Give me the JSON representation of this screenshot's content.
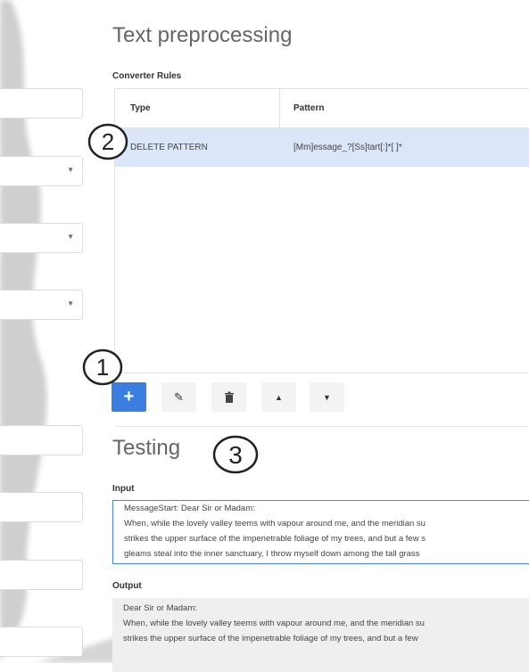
{
  "page": {
    "title": "Text preprocessing",
    "converter_rules_label": "Converter Rules"
  },
  "rules_table": {
    "columns": [
      "Type",
      "Pattern"
    ],
    "rows": [
      {
        "type": "DELETE PATTERN",
        "pattern": "[Mm]essage_?[Ss]tart[:]*[ ]*"
      }
    ],
    "selected_row": 0
  },
  "toolbar": {
    "buttons": [
      {
        "name": "add",
        "icon": "plus-icon",
        "glyph": "+"
      },
      {
        "name": "edit",
        "icon": "pencil-icon",
        "glyph": "✎"
      },
      {
        "name": "delete",
        "icon": "trash-icon",
        "glyph": "🗑"
      },
      {
        "name": "move-up",
        "icon": "triangle-up-icon",
        "glyph": "▲"
      },
      {
        "name": "move-down",
        "icon": "triangle-down-icon",
        "glyph": "▼"
      }
    ]
  },
  "testing": {
    "title": "Testing",
    "input_label": "Input",
    "input_lines": [
      "MessageStart: Dear Sir or Madam:",
      "When, while the lovely valley teems with vapour around me, and the meridian su",
      "strikes the upper surface of the impenetrable foliage of my trees, and but a few s",
      "gleams steal into the inner sanctuary, I throw myself down among the tall grass"
    ],
    "output_label": "Output",
    "output_lines": [
      "Dear Sir or Madam:",
      "When, while the lovely valley teems with vapour around me, and the meridian su",
      "strikes the upper surface of the impenetrable foliage of my trees, and but a few"
    ]
  },
  "callouts": [
    "1",
    "2",
    "3"
  ],
  "colors": {
    "primary": "#3a7fe0",
    "selected_row": "#dbe6f9",
    "input_border": "#4a86d9",
    "output_bg": "#efefef"
  }
}
